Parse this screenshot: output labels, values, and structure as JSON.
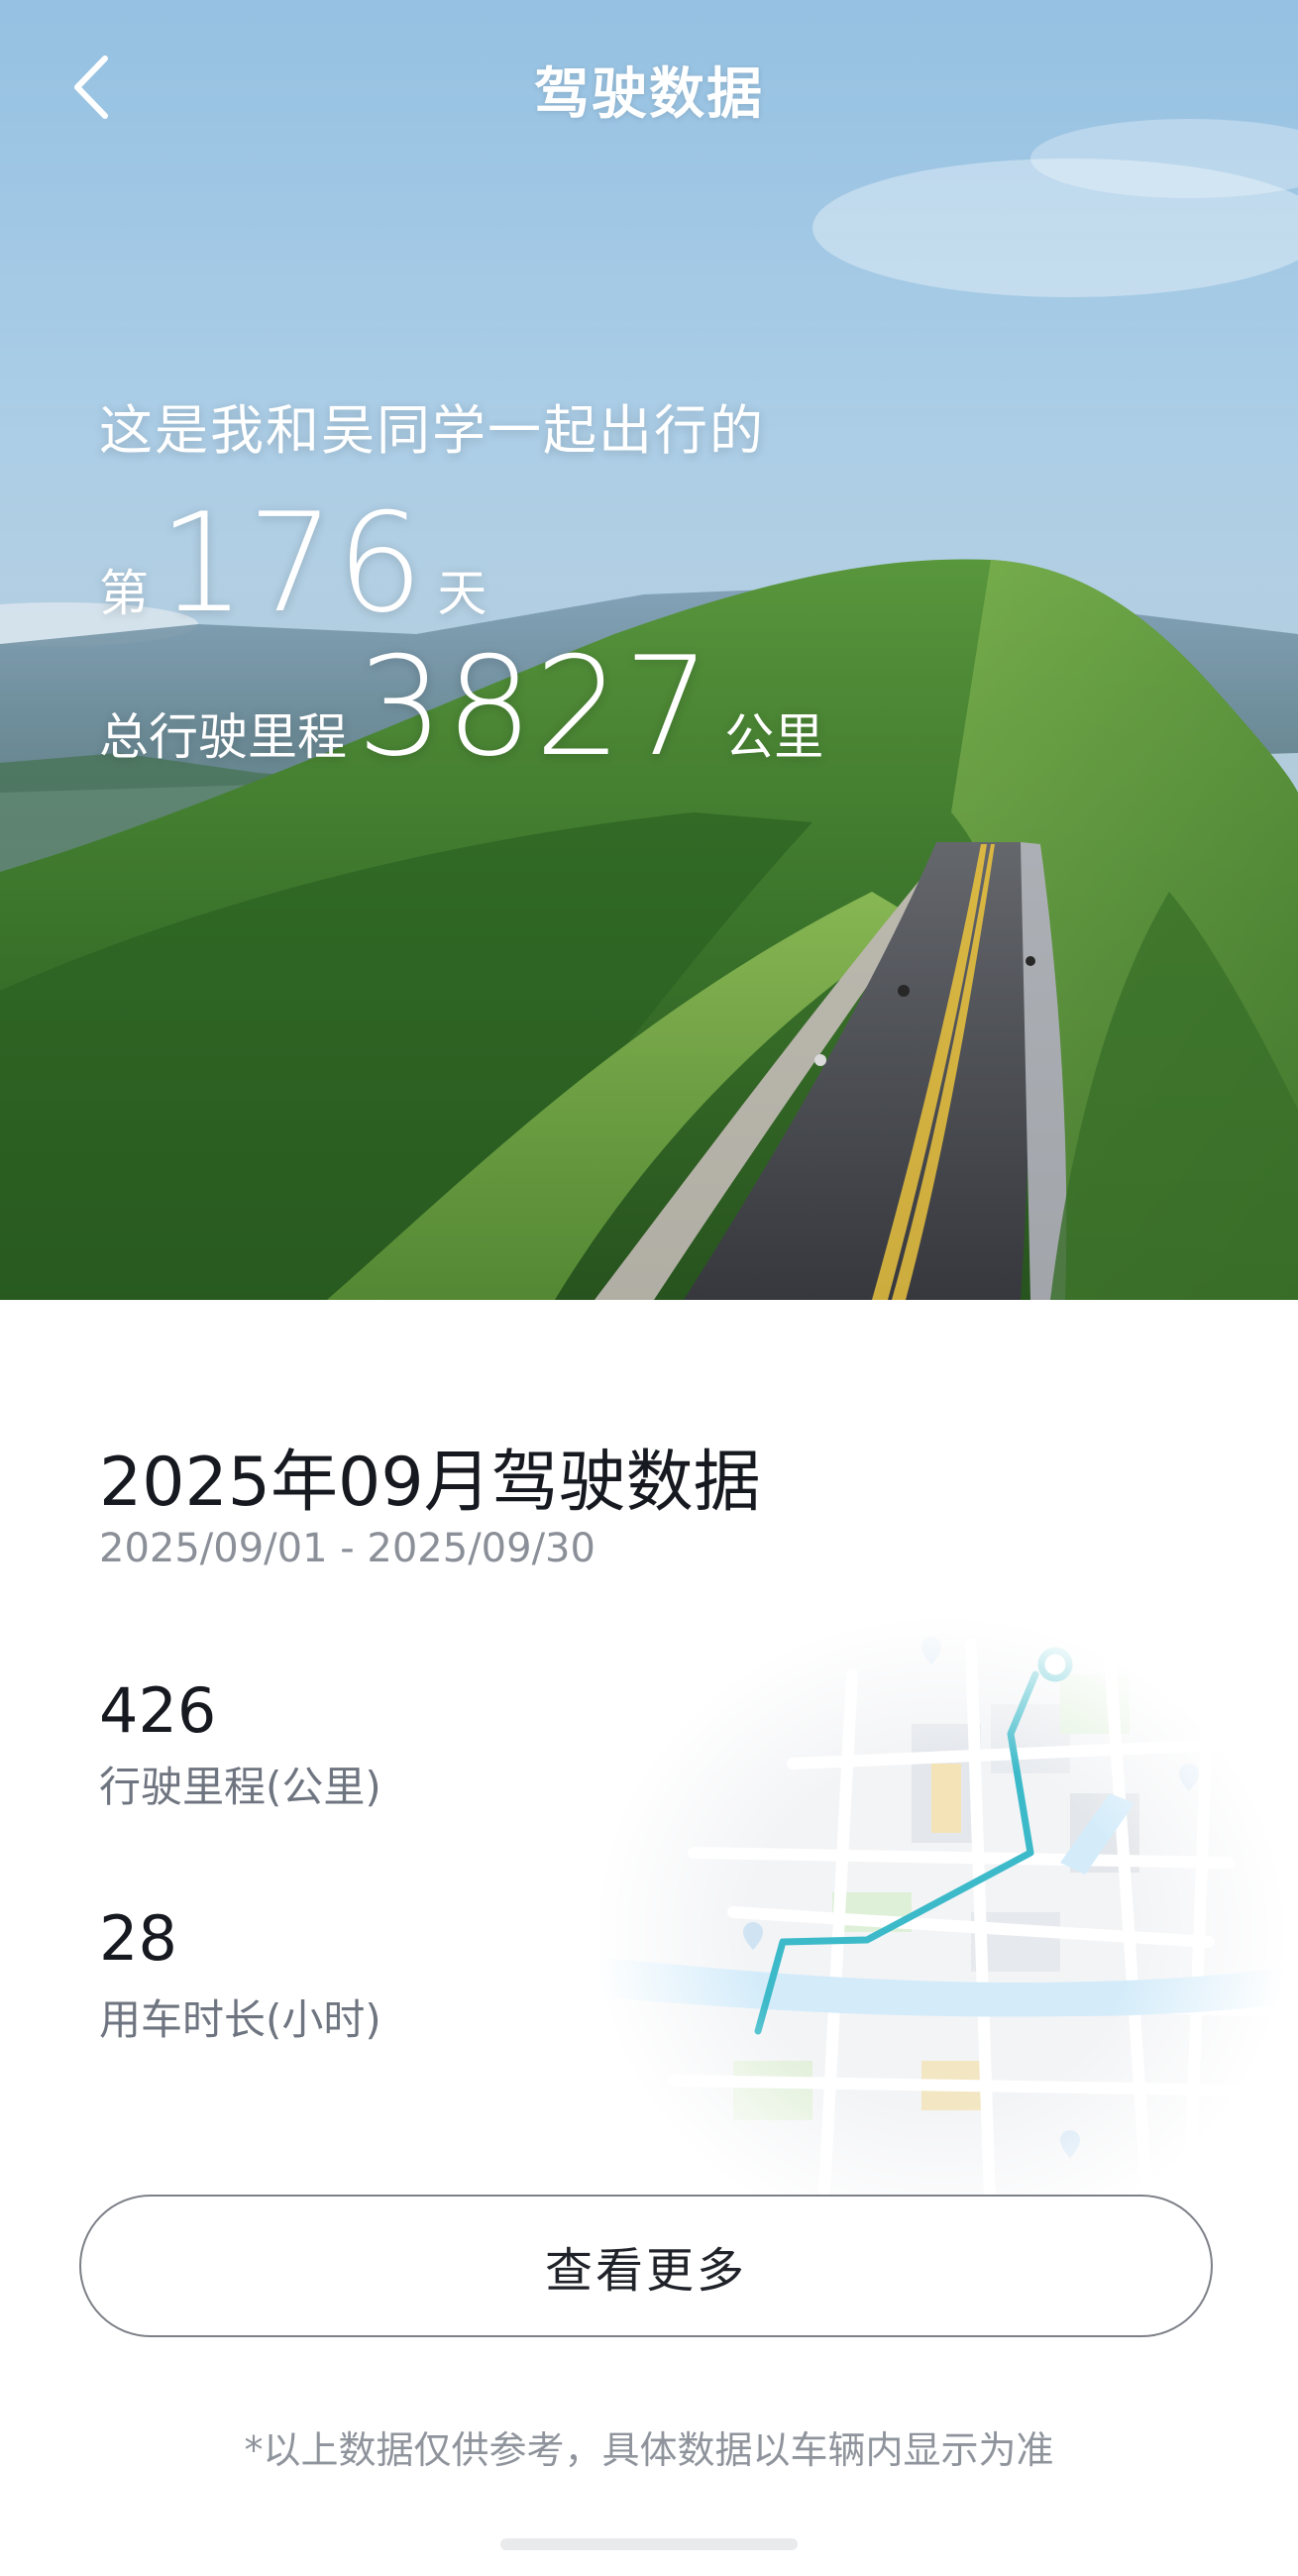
{
  "header": {
    "back_icon": "chevron-left-icon",
    "title": "驾驶数据"
  },
  "hero": {
    "intro": "这是我和吴同学一起出行的",
    "day_prefix": "第",
    "day_count": "176",
    "day_suffix": "天",
    "mileage_label": "总行驶里程",
    "mileage_value": "3827",
    "mileage_unit": "公里"
  },
  "monthly": {
    "title": "2025年09月驾驶数据",
    "date_range": "2025/09/01 - 2025/09/30",
    "stats": [
      {
        "value": "426",
        "label": "行驶里程(公里)"
      },
      {
        "value": "28",
        "label": "用车时长(小时)"
      }
    ],
    "map_icon": "route-map-illustration"
  },
  "actions": {
    "more_label": "查看更多"
  },
  "footer": {
    "disclaimer": "*以上数据仅供参考，具体数据以车辆内显示为准"
  },
  "colors": {
    "route": "#3dbac9",
    "sky": "#a9cde6",
    "hill": "#4e8f3a"
  }
}
